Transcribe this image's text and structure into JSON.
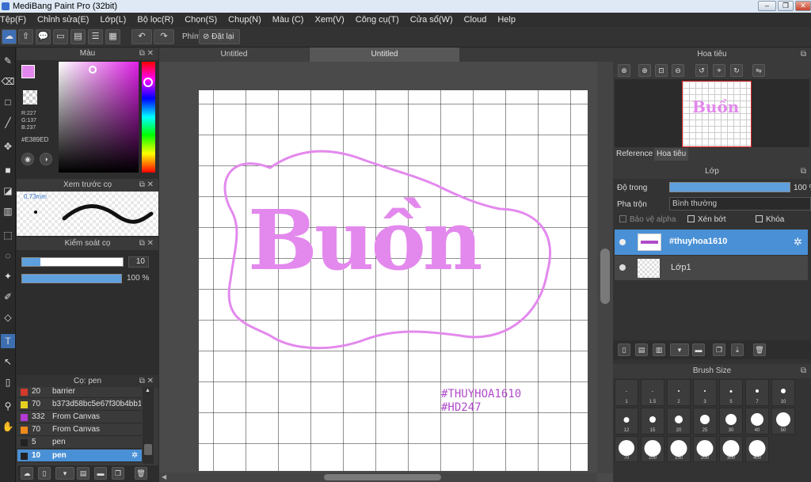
{
  "window": {
    "title": "MediBang Paint Pro (32bit)"
  },
  "menu": [
    "Tệp(F)",
    "Chỉnh sửa(E)",
    "Lớp(L)",
    "Bộ lọc(R)",
    "Chọn(S)",
    "Chụp(N)",
    "Màu (C)",
    "Xem(V)",
    "Công cụ(T)",
    "Cửa sổ(W)",
    "Cloud",
    "Help"
  ],
  "toolbar": {
    "key_label": "Phím",
    "reset_label": "Đặt lại"
  },
  "color_panel": {
    "title": "Màu",
    "r": "R:227",
    "g": "G:137",
    "b": "B:237",
    "hex": "#E389ED",
    "primary_color": "#E389ED"
  },
  "brush_preview": {
    "title": "Xem trước cọ",
    "size": "0.73mm"
  },
  "brush_control": {
    "title": "Kiểm soát cọ",
    "size_value": "10",
    "opacity_value": "100 %"
  },
  "brush_list": {
    "title": "Cọ: pen",
    "items": [
      {
        "size": "20",
        "name": "barrier",
        "color": "#d33a2c"
      },
      {
        "size": "70",
        "name": "b373d58bc5e67f30b4bb1",
        "color": "#e6d020"
      },
      {
        "size": "332",
        "name": "From Canvas",
        "color": "#b33ad3"
      },
      {
        "size": "70",
        "name": "From Canvas",
        "color": "#f08a1c"
      },
      {
        "size": "5",
        "name": "pen",
        "color": "#222222"
      },
      {
        "size": "10",
        "name": "pen",
        "color": "#222222",
        "selected": true
      }
    ]
  },
  "tabs": [
    "Untitled",
    "Untitled"
  ],
  "artwork": {
    "title": "Buồn",
    "tag1": "#THUYHOA1610",
    "tag2": "#HD247",
    "ink": "#E389ED",
    "tag_ink": "#b04cc9"
  },
  "navigator": {
    "title": "Hoa tiêu",
    "tab_reference": "Reference",
    "tab_navigator": "Hoa tiêu",
    "thumb_text": "Buồn"
  },
  "layers": {
    "title": "Lớp",
    "opacity_label": "Độ trong",
    "opacity_value": "100 %",
    "opacity_fraction": 1.0,
    "blend_label": "Pha trộn",
    "blend_value": "Bình thường",
    "protect_alpha": "Bảo vệ alpha",
    "clipping": "Xén bớt",
    "lock": "Khóa",
    "items": [
      {
        "name": "#thuyhoa1610",
        "selected": true
      },
      {
        "name": "Lớp1",
        "selected": false
      }
    ]
  },
  "brush_size": {
    "title": "Brush Size",
    "sizes": [
      "1",
      "1.5",
      "2",
      "3",
      "5",
      "7",
      "10",
      "12",
      "15",
      "20",
      "25",
      "30",
      "40",
      "50",
      "70",
      "100",
      "150",
      "200",
      "300",
      "400"
    ]
  }
}
